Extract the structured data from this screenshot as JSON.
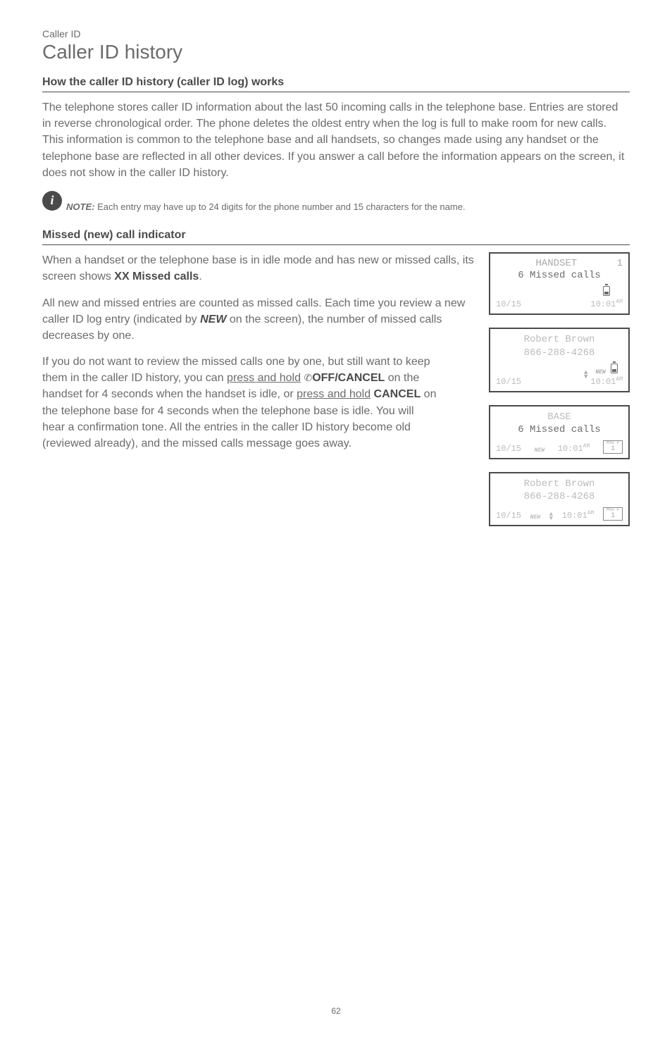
{
  "breadcrumb": "Caller ID",
  "page_title": "Caller ID history",
  "section1": {
    "heading": "How the caller ID history (caller ID log) works",
    "body": "The telephone stores caller ID information about the last 50 incoming calls in the telephone base. Entries are stored in reverse chronological order. The phone deletes the oldest entry when the log is full to make room for new calls. This information is common to the telephone base and all handsets, so changes made using any handset or the telephone base are reflected in all other devices. If you answer a call before the information appears on the screen, it does not show in the caller ID history."
  },
  "note": {
    "label": "NOTE:",
    "text": " Each entry may have up to 24 digits for the phone number and 15 characters for the name."
  },
  "section2": {
    "heading": "Missed (new) call indicator",
    "p1_a": "When a handset or the telephone base is in idle mode and has new or missed calls, its screen shows ",
    "p1_b": "XX Missed calls",
    "p1_c": ".",
    "p2_a": "All new and missed entries are counted as missed calls. Each time you review a new caller ID log entry (indicated by ",
    "p2_b": "NEW",
    "p2_c": " on the screen), the number of missed calls decreases by one.",
    "p3_a": "If you do not want to review the missed calls one by one, but still want to keep them in the caller ID history, you can ",
    "p3_u1": "press and hold",
    "p3_b": "OFF/CANCEL",
    "p3_c": " on the handset for 4 seconds when the handset is idle, or ",
    "p3_u2": "press and hold",
    "p3_d": " ",
    "p3_e": "CANCEL",
    "p3_f": " on the telephone base for 4 seconds when the telephone base is idle. You will hear a confirmation tone. All the entries in the caller ID history become old (reviewed already), and the missed calls message goes away."
  },
  "screens": {
    "handset1": {
      "title": "HANDSET",
      "num": "1",
      "missed": "6 Missed calls",
      "date": "10/15",
      "time": "10:01",
      "ampm": "AM"
    },
    "handset2": {
      "name": "Robert Brown",
      "phone": "866-288-4268",
      "new": "NEW",
      "date": "10/15",
      "time": "10:01",
      "ampm": "AM"
    },
    "base1": {
      "title": "BASE",
      "missed": "6 Missed calls",
      "date": "10/15",
      "new": "NEW",
      "time": "10:01",
      "ampm": "AM",
      "msg_label": "MSG #",
      "msg": "1"
    },
    "base2": {
      "name": "Robert Brown",
      "phone": "866-288-4268",
      "date": "10/15",
      "new": "NEW",
      "time": "10:01",
      "ampm": "AM",
      "msg_label": "MSG #",
      "msg": "1"
    }
  },
  "page_number": "62"
}
